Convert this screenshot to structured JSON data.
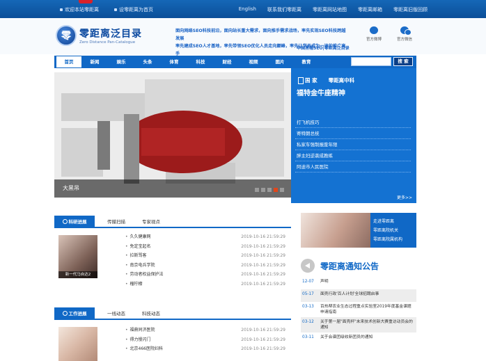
{
  "topbar": {
    "left": [
      "欢迎本站零距离",
      "设零距离为首页"
    ],
    "right": [
      "English",
      "联系我们零距离",
      "零距离网站地图",
      "零距离邮箱",
      "零距离旧版回顾"
    ]
  },
  "header": {
    "logo_mark": "零",
    "logo_title": "零距离泛目录",
    "logo_subtitle": "Zero Distance Pan-Catalogue",
    "slogan_lines": [
      "面向网络SEO科技前沿，面向站长重大需求，面向推手需求战场，率先实现SEO科技跨越发展",
      "率先建成SEO人才基地，率先带领SEO优化人员走向巅峰，率先让学员成为一流的推广高手"
    ],
    "slogan_sub": "中国黑帽SEO|零距离泛目录",
    "social": [
      "官方微博",
      "官方微信"
    ]
  },
  "nav": {
    "tabs": [
      "首页",
      "新闻",
      "娱乐",
      "头条",
      "体育",
      "科技",
      "财经",
      "视频",
      "图片",
      "教育"
    ],
    "search_placeholder": "",
    "search_button": "搜 索"
  },
  "banner": {
    "caption": "大黑吊"
  },
  "bluepanel": {
    "head": [
      "国 家",
      "零距离中科"
    ],
    "title": "福特金牛座精神",
    "items": [
      "打飞机技巧",
      "寄特朗总统",
      "私家车强制报废年限",
      "胖主妇逆袭成教练",
      "阿迪市人民医院"
    ],
    "more": "更多>>"
  },
  "section1": {
    "tabs": [
      "科研进展",
      "传媒扫描",
      "专家视点"
    ],
    "thumb_caption": "新一代马自达2",
    "rows": [
      {
        "title": "久久健康网",
        "date": "2019-10-16 21:59:29"
      },
      {
        "title": "免定宝起名",
        "date": "2019-10-16 21:59:29"
      },
      {
        "title": "拉斯骂客",
        "date": "2019-10-16 21:59:29"
      },
      {
        "title": "南京电兵学院",
        "date": "2019-10-16 21:59:29"
      },
      {
        "title": "劳动者权益保护法",
        "date": "2019-10-16 21:59:29"
      },
      {
        "title": "榴柠檬",
        "date": "2019-10-16 21:59:29"
      }
    ]
  },
  "section2": {
    "tabs": [
      "工作进展",
      "一线动态",
      "科技动态"
    ],
    "rows": [
      {
        "title": "福鼎同济医院",
        "date": "2019-10-16 21:59:29"
      },
      {
        "title": "得力慢闪门",
        "date": "2019-10-16 21:59:29"
      },
      {
        "title": "北京466医院妇科",
        "date": "2019-10-16 21:59:29"
      }
    ]
  },
  "side": {
    "links": [
      "走进零距离",
      "零距离院机关",
      "零距离院属机构"
    ]
  },
  "notice": {
    "title": "零距离通知公告",
    "rows": [
      {
        "date": "12-07",
        "text": "声明"
      },
      {
        "date": "05-17",
        "text": "面壳行政'百人计划'全球招聘启事"
      },
      {
        "date": "03-13",
        "text": "百热帮农业生态过程重点实验室2019年度基金课题申请指南"
      },
      {
        "date": "03-12",
        "text": "关于第一届\"面壳杯\"未来技术创新大赛重访动员会的通知"
      },
      {
        "date": "03-11",
        "text": "关于会谱团级收新团员的通知"
      }
    ]
  }
}
